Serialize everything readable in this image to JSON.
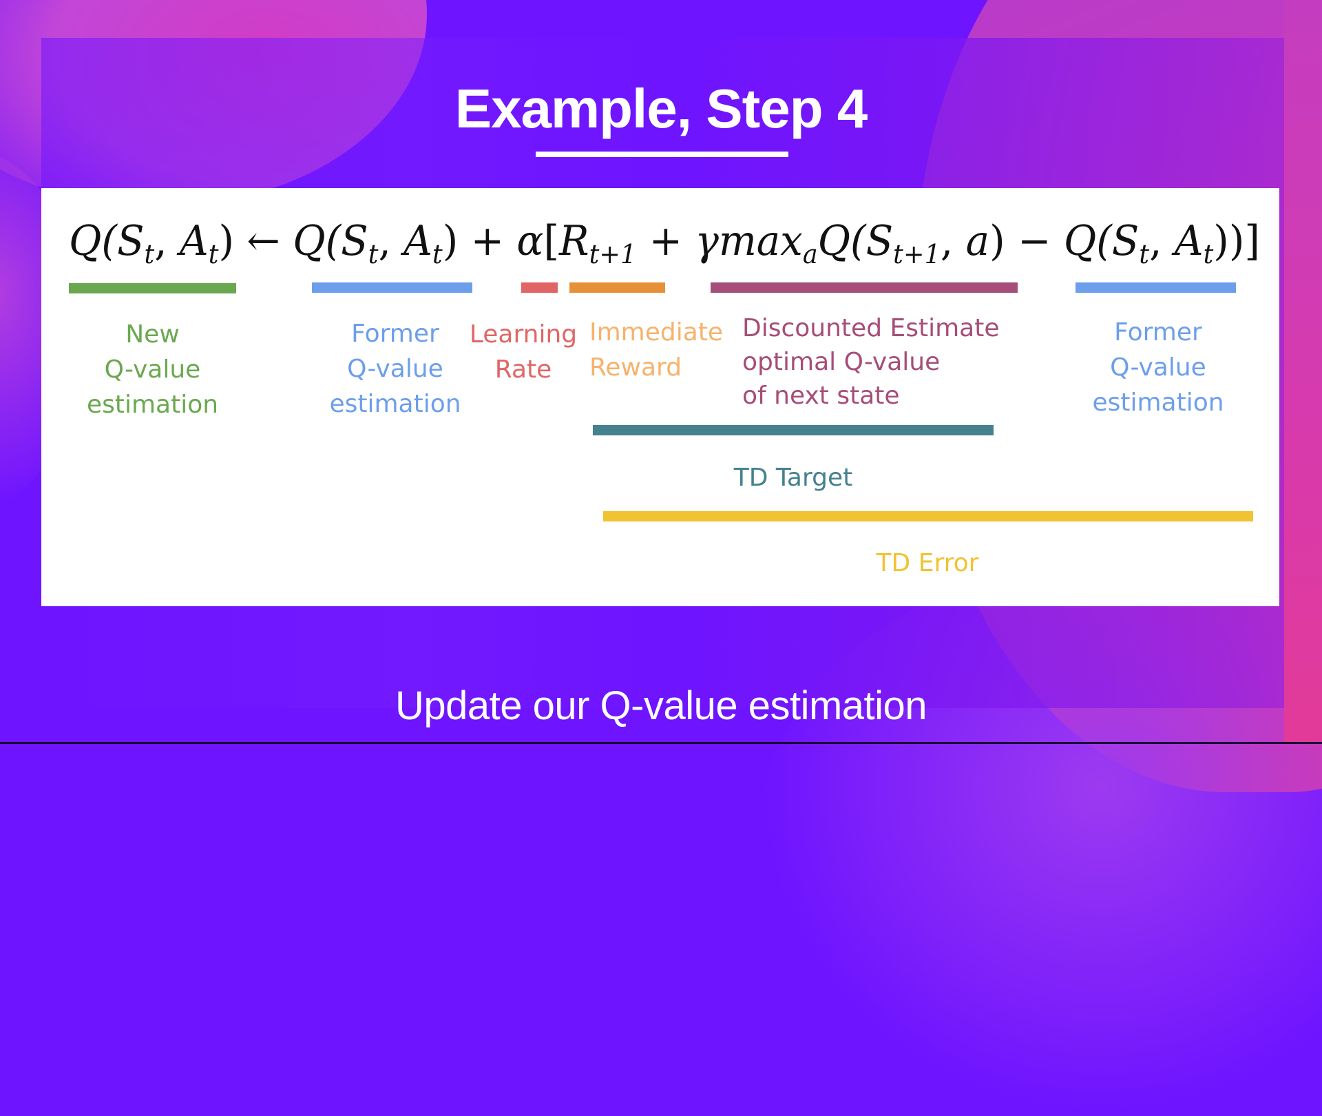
{
  "slide": {
    "title": "Example, Step 4",
    "subtitle": "Update our Q-value estimation"
  },
  "formula": {
    "latex": "Q(S_t, A_t) \\leftarrow Q(S_t, A_t) + \\alpha[R_{t+1} + \\gamma max_a Q(S_{t+1}, a) - Q(S_t, A_t)]",
    "parts": {
      "lhs_q": "Q(",
      "lhs_s": "S",
      "lhs_s_sub": "t",
      "lhs_comma": ", ",
      "lhs_a": "A",
      "lhs_a_sub": "t",
      "lhs_close": ")",
      "arrow": " ← ",
      "old_q": "Q(",
      "old_s": "S",
      "old_s_sub": "t",
      "old_comma": ", ",
      "old_a": "A",
      "old_a_sub": "t",
      "old_close": ")",
      "plus1": " + ",
      "alpha": "α",
      "bracket_open": "[",
      "reward": "R",
      "reward_sub": "t+1",
      "plus2": " + ",
      "gamma_max": "γmax",
      "max_sub": "a",
      "next_q": "Q(",
      "next_s": "S",
      "next_s_sub": "t+1",
      "next_comma": ", ",
      "next_a": "a",
      "next_close": ")",
      "minus": " − ",
      "cur_q": "Q(",
      "cur_s": "S",
      "cur_s_sub": "t",
      "cur_comma": ", ",
      "cur_a": "A",
      "cur_a_sub": "t",
      "cur_close": "))",
      "bracket_close": "]"
    }
  },
  "annotations": [
    {
      "id": "new-q",
      "lines": [
        "New",
        "Q-value",
        "estimation"
      ],
      "color": "#6aa84f"
    },
    {
      "id": "former-q",
      "lines": [
        "Former",
        "Q-value",
        "estimation"
      ],
      "color": "#6d9eeb"
    },
    {
      "id": "learning-rate",
      "lines": [
        "Learning",
        "Rate"
      ],
      "color": "#e06666"
    },
    {
      "id": "immediate-reward",
      "lines": [
        "Immediate",
        "Reward"
      ],
      "color": "#f6b26b"
    },
    {
      "id": "discounted-estimate",
      "lines": [
        "Discounted Estimate",
        "optimal Q-value",
        "of next state"
      ],
      "color": "#a64d79"
    },
    {
      "id": "former-q-2",
      "lines": [
        "Former",
        "Q-value",
        "estimation"
      ],
      "color": "#6d9eeb"
    },
    {
      "id": "td-target",
      "lines": [
        "TD Target"
      ],
      "color": "#45818e"
    },
    {
      "id": "td-error",
      "lines": [
        "TD Error"
      ],
      "color": "#f1c232"
    }
  ],
  "colors": {
    "background": "#6e14ff",
    "bar_green": "#6aa84f",
    "bar_blue": "#6d9eeb",
    "bar_red": "#e06666",
    "bar_orange": "#e69138",
    "bar_purple": "#a64d79",
    "bar_teal": "#45818e",
    "bar_yellow": "#f1c232"
  }
}
